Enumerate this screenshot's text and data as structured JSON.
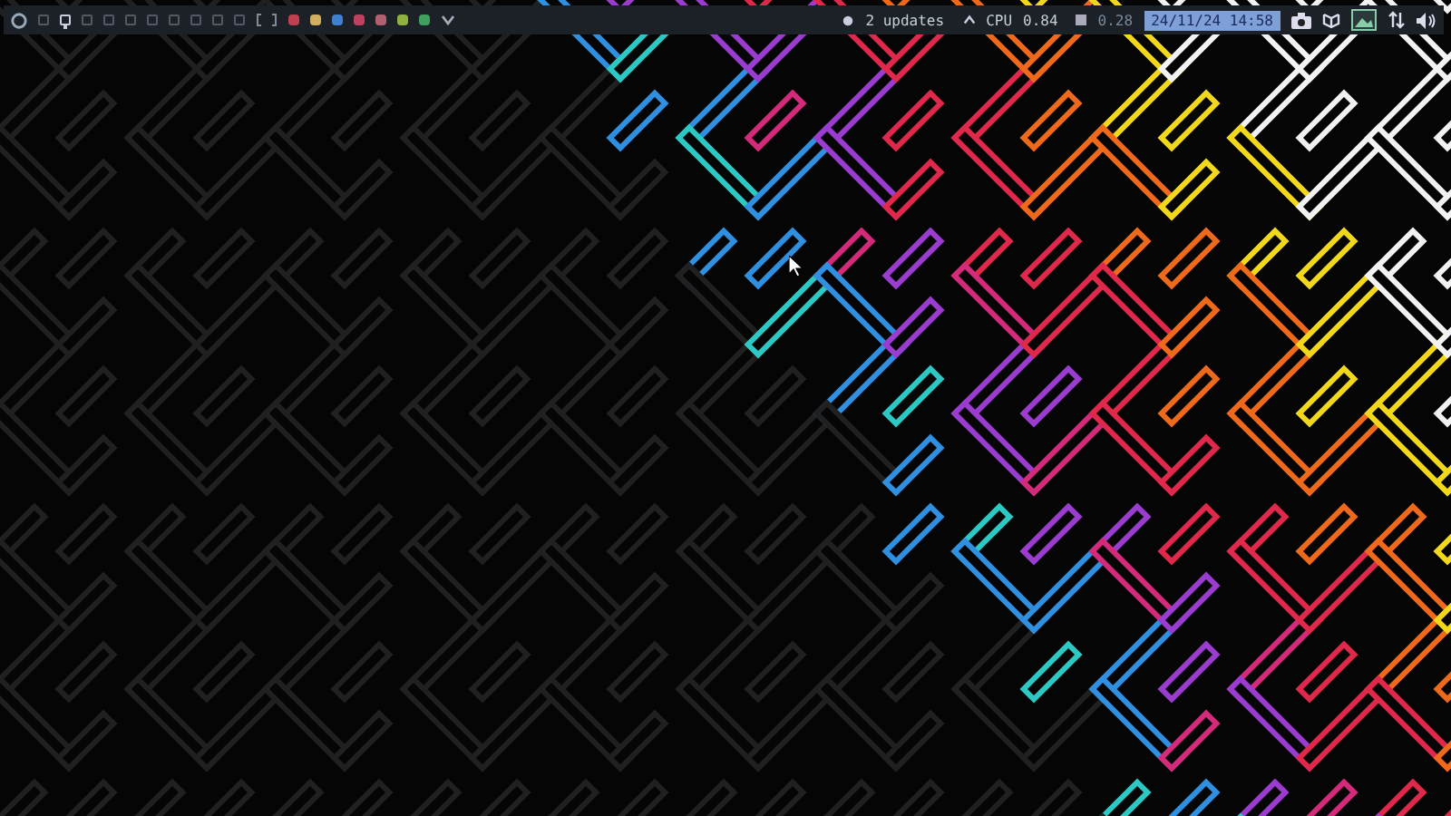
{
  "panel": {
    "workspaces": [
      {
        "selected": false
      },
      {
        "selected": true
      },
      {
        "selected": false
      },
      {
        "selected": false
      },
      {
        "selected": false
      },
      {
        "selected": false
      },
      {
        "selected": false
      },
      {
        "selected": false
      },
      {
        "selected": false
      },
      {
        "selected": false
      }
    ],
    "updates": "2 updates",
    "cpu_label": "CPU",
    "cpu_value": "0.84",
    "memory_value": "0.28",
    "clock": "24/11/24 14:58"
  }
}
